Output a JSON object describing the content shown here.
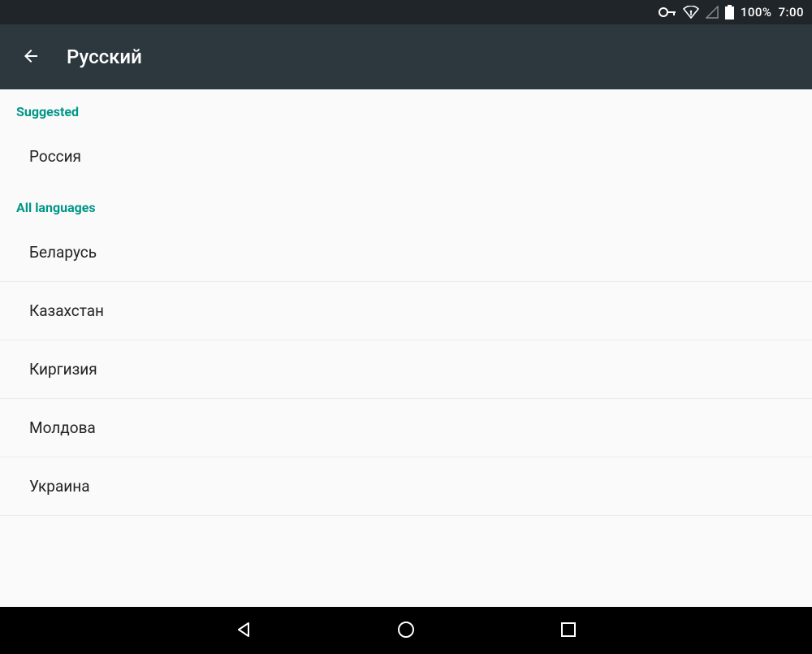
{
  "statusbar": {
    "battery_pct": "100%",
    "time": "7:00"
  },
  "actionbar": {
    "title": "Русский"
  },
  "sections": {
    "suggested_header": "Suggested",
    "all_header": "All languages"
  },
  "suggested": [
    "Россия"
  ],
  "all_languages": [
    "Беларусь",
    "Казахстан",
    "Киргизия",
    "Молдова",
    "Украина"
  ]
}
